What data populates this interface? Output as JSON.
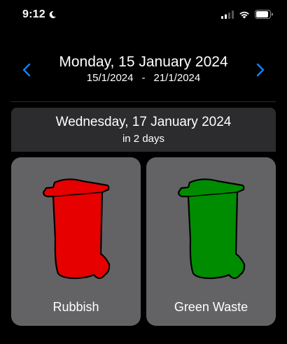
{
  "status": {
    "time": "9:12",
    "focus_icon": "moon-icon",
    "signal_icon": "cellular-signal-icon",
    "wifi_icon": "wifi-icon",
    "battery_icon": "battery-icon"
  },
  "week": {
    "title": "Monday, 15 January 2024",
    "range_start": "15/1/2024",
    "range_separator": "-",
    "range_end": "21/1/2024",
    "prev_icon": "chevron-left-icon",
    "next_icon": "chevron-right-icon",
    "accent": "#0a84ff"
  },
  "collection": {
    "date": "Wednesday, 17 January 2024",
    "relative": "in 2 days",
    "bins": [
      {
        "label": "Rubbish",
        "color": "#e60000",
        "icon": "wheelie-bin-icon"
      },
      {
        "label": "Green Waste",
        "color": "#008c00",
        "icon": "wheelie-bin-icon"
      }
    ]
  }
}
